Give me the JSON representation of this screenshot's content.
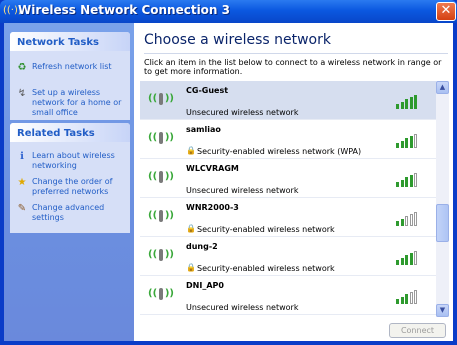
{
  "window": {
    "title": "Wireless Network Connection 3",
    "close_glyph": "✕",
    "icon": "wireless-icon"
  },
  "network_tasks": {
    "title": "Network Tasks",
    "items": [
      {
        "label": "Refresh network list",
        "icon": "refresh-icon"
      },
      {
        "label": "Set up a wireless network for a home or small office",
        "icon": "setup-wireless-icon"
      }
    ]
  },
  "related_tasks": {
    "title": "Related Tasks",
    "items": [
      {
        "label": "Learn about wireless networking",
        "icon": "info-icon"
      },
      {
        "label": "Change the order of preferred networks",
        "icon": "star-icon"
      },
      {
        "label": "Change advanced settings",
        "icon": "settings-icon"
      }
    ]
  },
  "main": {
    "heading": "Choose a wireless network",
    "instructions": "Click an item in the list below to connect to a wireless network in range or to get more information.",
    "connect_label": "Connect"
  },
  "networks": [
    {
      "name": "CG-Guest",
      "status": "Unsecured wireless network",
      "secured": false,
      "signal": 5
    },
    {
      "name": "samliao",
      "status": "Security-enabled wireless network (WPA)",
      "secured": true,
      "signal": 4
    },
    {
      "name": "WLCVRAGM",
      "status": "Unsecured wireless network",
      "secured": false,
      "signal": 4
    },
    {
      "name": "WNR2000-3",
      "status": "Security-enabled wireless network",
      "secured": true,
      "signal": 2
    },
    {
      "name": "dung-2",
      "status": "Security-enabled wireless network",
      "secured": true,
      "signal": 4
    },
    {
      "name": "DNI_AP0",
      "status": "Unsecured wireless network",
      "secured": false,
      "signal": 3
    }
  ],
  "colors": {
    "signal_on": "#2e9a2e",
    "lock": "#d8a000",
    "title_bar": "#0b58e0"
  }
}
